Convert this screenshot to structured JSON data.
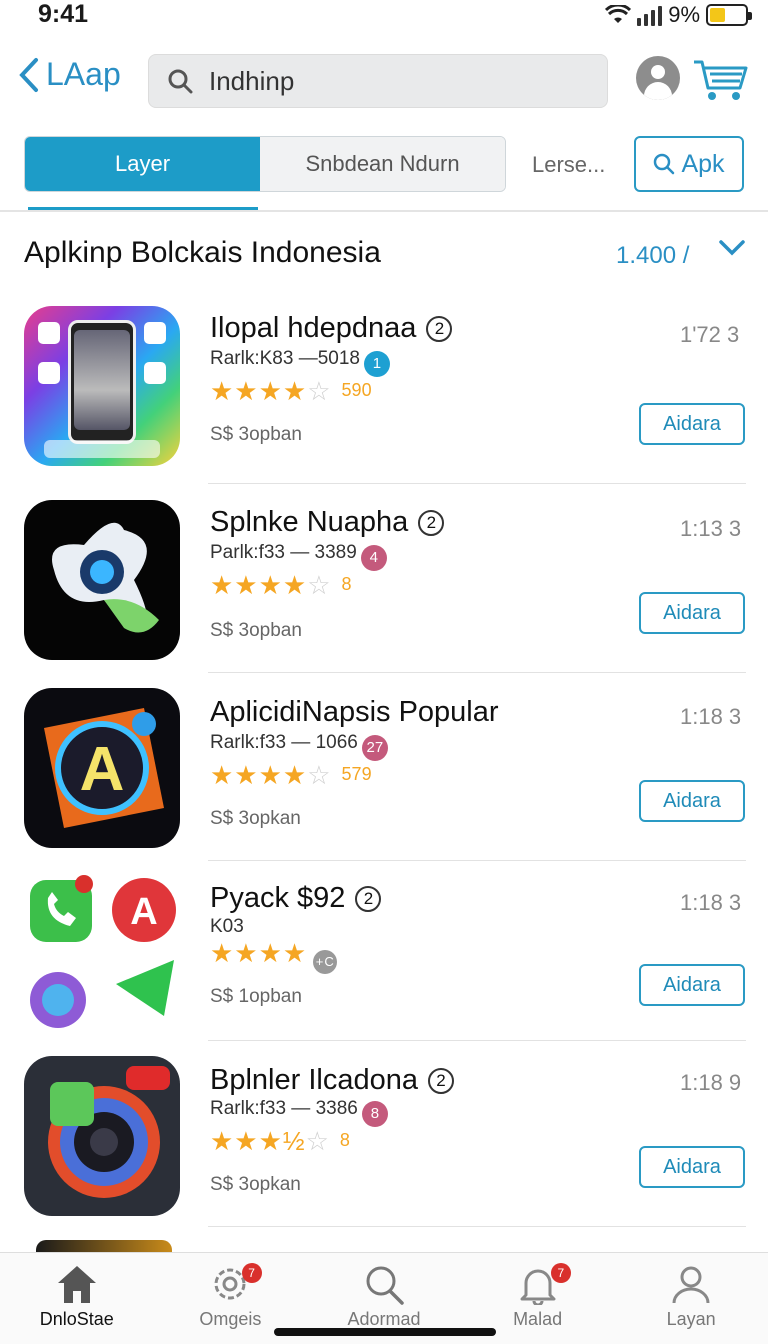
{
  "status_bar": {
    "time": "9:41",
    "battery": "9%",
    "battery_level": 0.45
  },
  "header": {
    "back_label": "LAap",
    "search_value": "Indhinp"
  },
  "tabs": {
    "active": "Layer",
    "inactive": "Snbdean Ndurn",
    "more": "Lerse...",
    "apk_button": "Apk"
  },
  "section": {
    "title": "Aplkinp Bolckais Indonesia",
    "count": "1.400 /"
  },
  "apps": [
    {
      "name": "Ilopal hdepdnaa",
      "verify": "2",
      "time": "1'72 3",
      "rank": "Rarlk:K83 —5018",
      "badge": "1",
      "badge_color": "#1ea0d2",
      "stars": "★★★★",
      "empty_stars": "☆",
      "rating": "590",
      "sub": "S$ 3opban",
      "button": "Aidara"
    },
    {
      "name": "Splnke Nuapha",
      "verify": "2",
      "time": "1:13 3",
      "rank": "Parlk:f33 — 3389",
      "badge": "4",
      "badge_color": "#c45a7c",
      "stars": "★★★★",
      "empty_stars": "☆",
      "rating": "8",
      "sub": "S$ 3opban",
      "button": "Aidara"
    },
    {
      "name": "AplicidiNapsis Popular",
      "verify": "",
      "time": "1:18 3",
      "rank": "Rarlk:f33 — 1066",
      "badge": "27",
      "badge_color": "#c45a7c",
      "stars": "★★★★",
      "empty_stars": "☆",
      "rating": "579",
      "sub": "S$ 3opkan",
      "button": "Aidara"
    },
    {
      "name": "Pyack $92",
      "verify": "2",
      "time": "1:18 3",
      "rank": "K03",
      "badge": "",
      "badge_color": "#999999",
      "stars": "★★★★",
      "empty_stars": "",
      "rating": "",
      "sub": "S$ 1opban",
      "button": "Aidara"
    },
    {
      "name": "Bplnler Ilcadona",
      "verify": "2",
      "time": "1:18 9",
      "rank": "Rarlk:f33 — 3386",
      "badge": "8",
      "badge_color": "#c45a7c",
      "stars": "★★★½",
      "empty_stars": "☆",
      "rating": "8",
      "sub": "S$ 3opkan",
      "button": "Aidara"
    }
  ],
  "nav": [
    {
      "label": "DnloStae",
      "icon": "home-icon",
      "badge": ""
    },
    {
      "label": "Omgeis",
      "icon": "gear-icon",
      "badge": "7"
    },
    {
      "label": "Adormad",
      "icon": "search-icon",
      "badge": ""
    },
    {
      "label": "Malad",
      "icon": "bell-icon",
      "badge": "7"
    },
    {
      "label": "Layan",
      "icon": "user-icon",
      "badge": ""
    }
  ],
  "colors": {
    "accent": "#1d9cc8",
    "star": "#f5a623",
    "badge_red": "#d9302c"
  }
}
